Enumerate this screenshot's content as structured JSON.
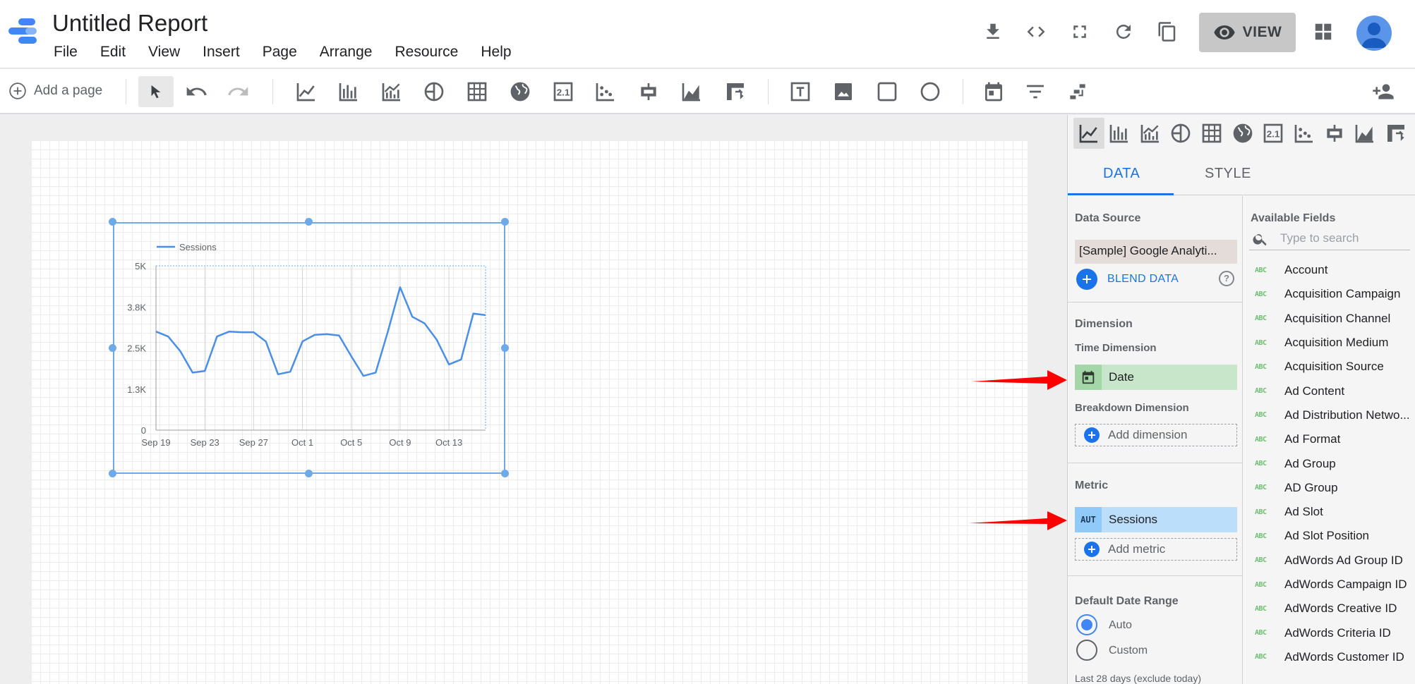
{
  "app": {
    "title": "Untitled Report",
    "menu": [
      "File",
      "Edit",
      "View",
      "Insert",
      "Page",
      "Arrange",
      "Resource",
      "Help"
    ],
    "view_button": "VIEW"
  },
  "toolbar": {
    "add_page": "Add a page"
  },
  "chart_data": {
    "type": "line",
    "legend": [
      "Sessions"
    ],
    "x_tick_labels": [
      "Sep 19",
      "Sep 23",
      "Sep 27",
      "Oct 1",
      "Oct 5",
      "Oct 9",
      "Oct 13"
    ],
    "y_tick_labels": [
      "0",
      "1.3K",
      "2.5K",
      "3.8K",
      "5K"
    ],
    "ylim": [
      0,
      5000
    ],
    "series": [
      {
        "name": "Sessions",
        "values": [
          3000,
          2850,
          2400,
          1750,
          1800,
          2850,
          3000,
          2980,
          2980,
          2700,
          1700,
          1780,
          2700,
          2900,
          2920,
          2880,
          2250,
          1650,
          1750,
          3000,
          4350,
          3450,
          3250,
          2750,
          2000,
          2150,
          3550,
          3500
        ]
      }
    ]
  },
  "panel": {
    "tabs": [
      "DATA",
      "STYLE"
    ],
    "data_source_title": "Data Source",
    "data_source_value": "[Sample] Google Analyti...",
    "blend_data": "BLEND DATA",
    "help": "?",
    "dimension_title": "Dimension",
    "time_dimension_title": "Time Dimension",
    "time_dimension_value": "Date",
    "breakdown_title": "Breakdown Dimension",
    "add_dimension": "Add dimension",
    "metric_title": "Metric",
    "metric_badge": "AUT",
    "metric_value": "Sessions",
    "add_metric": "Add metric",
    "date_range_title": "Default Date Range",
    "radio_auto": "Auto",
    "radio_custom": "Custom",
    "date_range_note": "Last 28 days (exclude today)",
    "available_fields_title": "Available Fields",
    "search_placeholder": "Type to search",
    "field_type_label": "ABC",
    "fields": [
      "Account",
      "Acquisition Campaign",
      "Acquisition Channel",
      "Acquisition Medium",
      "Acquisition Source",
      "Ad Content",
      "Ad Distribution Netwo...",
      "Ad Format",
      "Ad Group",
      "AD Group",
      "Ad Slot",
      "Ad Slot Position",
      "AdWords Ad Group ID",
      "AdWords Campaign ID",
      "AdWords Creative ID",
      "AdWords Criteria ID",
      "AdWords Customer ID"
    ]
  },
  "colors": {
    "accent": "#1a73e8",
    "series_line": "#4a8fe7",
    "selection": "#6eaae8",
    "dimension_chip": "#c8e6c9",
    "metric_chip": "#bbdefb",
    "arrow": "#ff0000"
  }
}
